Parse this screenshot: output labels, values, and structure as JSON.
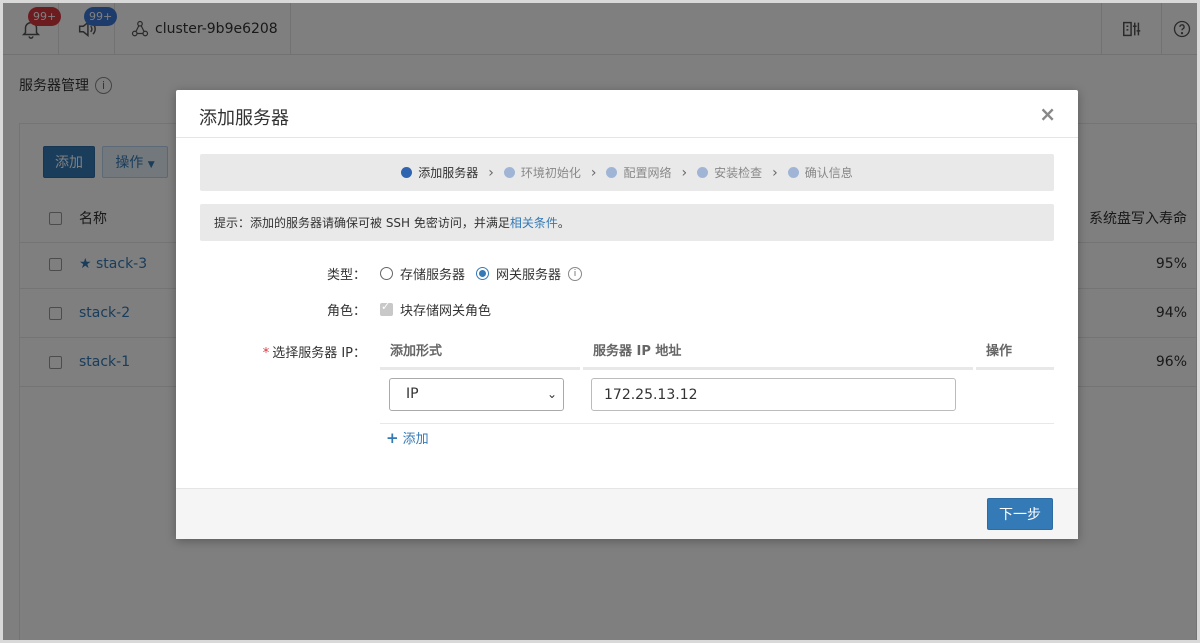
{
  "topbar": {
    "alerts_badge": "99+",
    "notices_badge": "99+",
    "cluster_name": "cluster-9b9e6208"
  },
  "page": {
    "title": "服务器管理",
    "info_glyph": "i",
    "add_button": "添加",
    "ops_button": "操作",
    "table": {
      "col_name": "名称",
      "col_life": "系统盘写入寿命",
      "rows": [
        {
          "name": "stack-3",
          "starred": true,
          "life": "95%"
        },
        {
          "name": "stack-2",
          "starred": false,
          "life": "94%"
        },
        {
          "name": "stack-1",
          "starred": false,
          "life": "96%"
        }
      ]
    }
  },
  "modal": {
    "title": "添加服务器",
    "close_glyph": "×",
    "steps": [
      {
        "label": "添加服务器",
        "active": true
      },
      {
        "label": "环境初始化",
        "active": false
      },
      {
        "label": "配置网络",
        "active": false
      },
      {
        "label": "安装检查",
        "active": false
      },
      {
        "label": "确认信息",
        "active": false
      }
    ],
    "tip_prefix": "提示：添加的服务器请确保可被 SSH 免密访问，并满足",
    "tip_link": "相关条件",
    "tip_suffix": "。",
    "type_label": "类型：",
    "type_options": [
      {
        "label": "存储服务器",
        "checked": false
      },
      {
        "label": "网关服务器",
        "checked": true
      }
    ],
    "role_label": "角色：",
    "role_option": "块存储网关角色",
    "ip_label": "选择服务器 IP：",
    "ip_table": {
      "col_method": "添加形式",
      "col_ip": "服务器 IP 地址",
      "col_ops": "操作",
      "row": {
        "method": "IP",
        "ip": "172.25.13.12"
      }
    },
    "add_row": "添加",
    "next_button": "下一步"
  },
  "colors": {
    "primary": "#337ab7",
    "badge_red": "#d9363e",
    "badge_blue": "#3a78d8",
    "step_active": "#2f64b0"
  }
}
